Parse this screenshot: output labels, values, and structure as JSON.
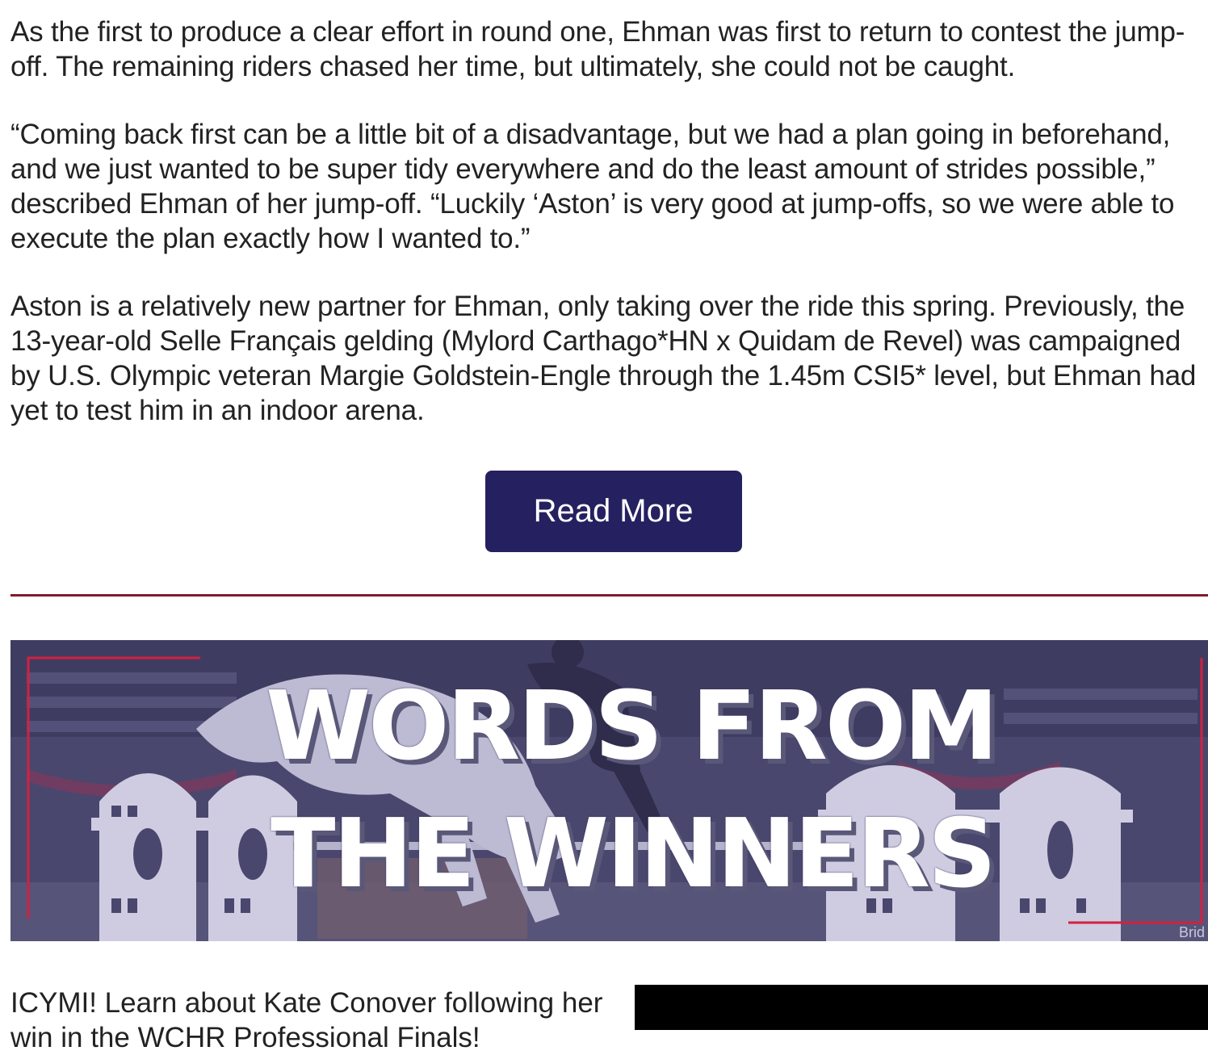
{
  "article": {
    "paragraphs": [
      "As the first to produce a clear effort in round one, Ehman was first to return to contest the jump-off. The remaining riders chased her time, but ultimately, she could not be caught.",
      "“Coming back first can be a little bit of a disadvantage, but we had a plan going in beforehand, and we just wanted to be super tidy everywhere and do the least amount of strides possible,” described Ehman of her jump-off. “Luckily ‘Aston’ is very good at jump-offs, so we were able to execute the plan exactly how I wanted to.”",
      "Aston is a relatively new partner for Ehman, only taking over the ride this spring. Previously, the 13-year-old Selle Français gelding (Mylord Carthago*HN x Quidam de Revel) was campaigned by U.S. Olympic veteran Margie Goldstein-Engle through the 1.45m CSI5* level, but Ehman had yet to test him in an indoor arena."
    ],
    "read_more_label": "Read More"
  },
  "banner": {
    "line1": "WORDS FROM",
    "line2": "THE WINNERS",
    "watermark": "Brid"
  },
  "next_section": {
    "text": "ICYMI! Learn about Kate Conover following her win in the WCHR Professional Finals!"
  },
  "colors": {
    "button_bg": "#25205f",
    "divider": "#7d1d2c",
    "banner_overlay": "#4d4a72"
  }
}
